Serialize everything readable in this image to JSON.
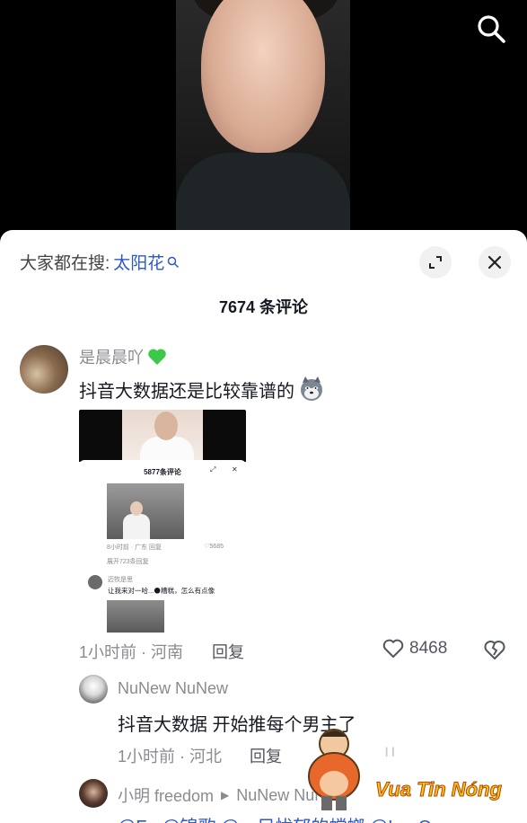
{
  "video": {
    "search_icon": "search-icon"
  },
  "sheet": {
    "trend_prefix": "大家都在搜:",
    "trend_keyword": "太阳花",
    "expand_icon": "expand-icon",
    "close_icon": "close-icon",
    "comment_count": "7674 条评论"
  },
  "comment": {
    "username": "是晨晨吖",
    "text": "抖音大数据还是比较靠谱的",
    "time_location": "1小时前 · 河南",
    "reply_label": "回复",
    "likes": "8468",
    "embedded": {
      "count": "5877条评论",
      "meta_left": "8小时前 · 广东   回复",
      "meta_likes": "♡5685",
      "expand": "展开723条回复",
      "reply_user": "迈牧是思",
      "reply_text": "让我来对一哈...🌑糟糕，怎么有点像"
    }
  },
  "reply1": {
    "username": "NuNew NuNew",
    "text": "抖音大数据 开始推每个男主了",
    "time_location": "1小时前 · 河北",
    "reply_label": "回复",
    "likes": "ıı"
  },
  "reply2": {
    "username": "小明 freedom",
    "reply_to": "NuNew NuNew",
    "text": "@Fu @锦歌 @一只忧郁的螳螂 @LanC"
  },
  "watermark": {
    "text": "Vua Tin Nóng"
  },
  "colors": {
    "link_blue": "#2d58c9",
    "meta_gray": "#8a8b91",
    "heart_green": "#3cc94a"
  }
}
